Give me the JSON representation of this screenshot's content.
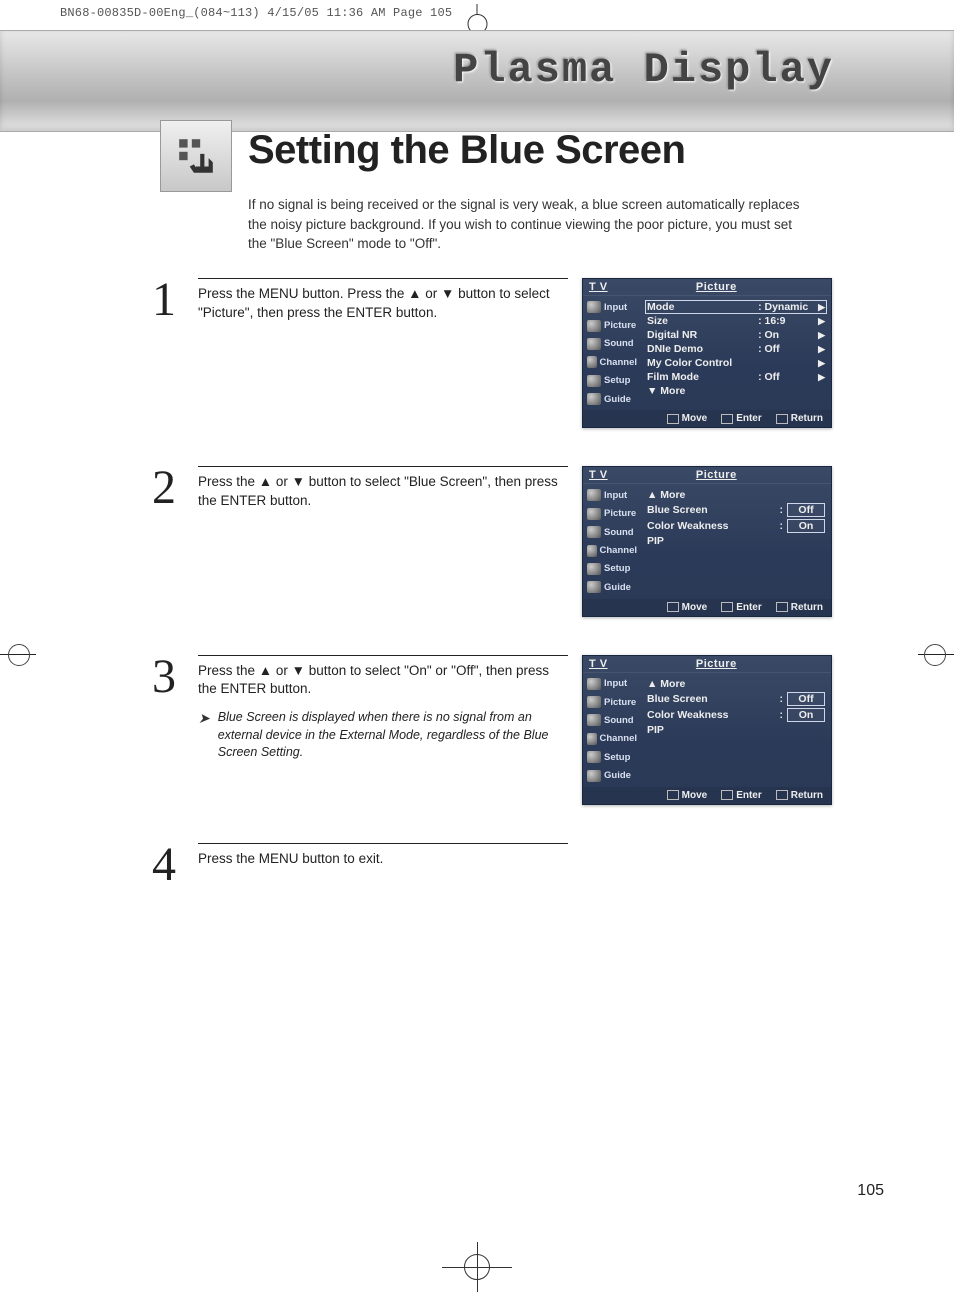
{
  "slug": "BN68-00835D-00Eng_(084~113)  4/15/05  11:36 AM  Page 105",
  "header": {
    "brand": "Plasma Display"
  },
  "page": {
    "title": "Setting the Blue Screen",
    "intro": "If no signal is being received or the signal is very weak, a blue screen automatically replaces the noisy picture background. If you wish to continue viewing the poor picture, you must set the \"Blue Screen\" mode to \"Off\".",
    "number": "105"
  },
  "sidebar_items": [
    "Input",
    "Picture",
    "Sound",
    "Channel",
    "Setup",
    "Guide"
  ],
  "steps": [
    {
      "num": "1",
      "text": "Press the MENU button. Press the ▲ or ▼ button to select \"Picture\", then press the ENTER button.",
      "osd": {
        "tv": "T V",
        "title": "Picture",
        "rows": [
          {
            "label": "Mode",
            "value": ": Dynamic",
            "caret": "▶",
            "sel": true
          },
          {
            "label": "Size",
            "value": ": 16:9",
            "caret": "▶"
          },
          {
            "label": "Digital NR",
            "value": ": On",
            "caret": "▶"
          },
          {
            "label": "DNIe Demo",
            "value": ": Off",
            "caret": "▶"
          },
          {
            "label": "My Color Control",
            "value": "",
            "caret": "▶"
          },
          {
            "label": "Film Mode",
            "value": ": Off",
            "caret": "▶"
          },
          {
            "label": "▼ More",
            "value": "",
            "caret": ""
          }
        ],
        "foot": [
          "Move",
          "Enter",
          "Return"
        ]
      }
    },
    {
      "num": "2",
      "text": "Press the ▲ or ▼ button to select \"Blue Screen\", then press the ENTER button.",
      "osd": {
        "tv": "T V",
        "title": "Picture",
        "rows": [
          {
            "label": "▲ More",
            "value": "",
            "caret": ""
          },
          {
            "label": "Blue Screen",
            "colon": ":",
            "box": "Off"
          },
          {
            "label": "Color Weakness",
            "colon": ":",
            "box": "On"
          },
          {
            "label": "PIP",
            "value": "",
            "caret": ""
          }
        ],
        "foot": [
          "Move",
          "Enter",
          "Return"
        ]
      }
    },
    {
      "num": "3",
      "text": "Press the ▲ or ▼ button to select \"On\" or \"Off\", then press the ENTER button.",
      "note": "Blue Screen is displayed when there is no signal from an external device in the External Mode, regardless of the Blue Screen Setting.",
      "osd": {
        "tv": "T V",
        "title": "Picture",
        "rows": [
          {
            "label": "▲ More",
            "value": "",
            "caret": ""
          },
          {
            "label": "Blue Screen",
            "colon": ":",
            "box": "Off"
          },
          {
            "label": "Color Weakness",
            "colon": ":",
            "box": "On"
          },
          {
            "label": "PIP",
            "value": "",
            "caret": ""
          }
        ],
        "foot": [
          "Move",
          "Enter",
          "Return"
        ]
      }
    },
    {
      "num": "4",
      "text": "Press the MENU button to exit."
    }
  ]
}
